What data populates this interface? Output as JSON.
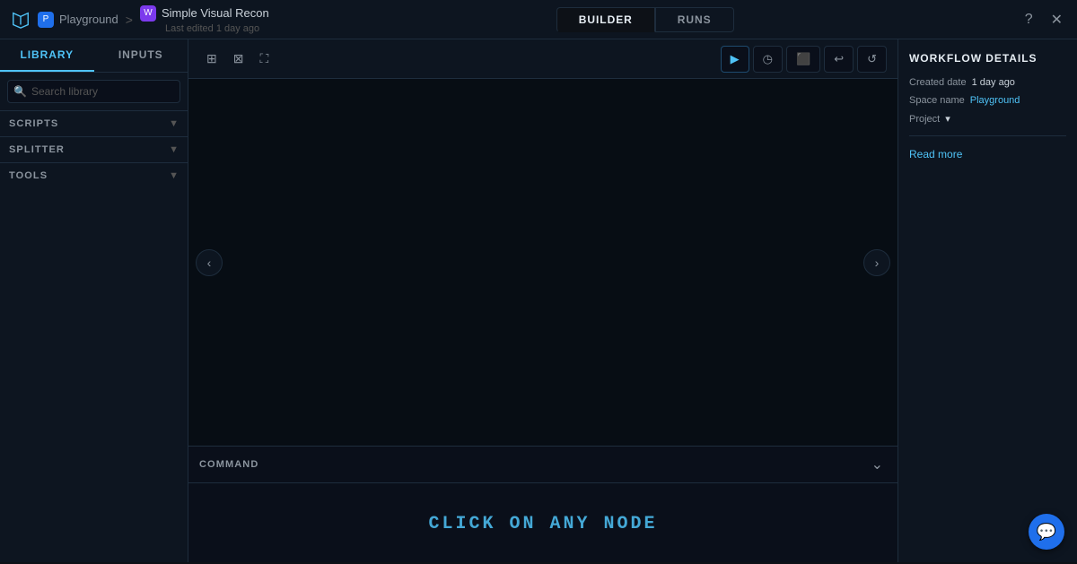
{
  "topbar": {
    "brand_icon": "▶",
    "breadcrumb": {
      "space_label": "Playground",
      "sep": ">",
      "workflow_label": "Simple Visual Recon"
    },
    "last_edited": "Last edited 1 day ago",
    "tabs": [
      {
        "id": "builder",
        "label": "BUILDER",
        "active": true
      },
      {
        "id": "runs",
        "label": "RUNS",
        "active": false
      }
    ],
    "help_icon": "?",
    "close_icon": "✕"
  },
  "sidebar": {
    "tabs": [
      {
        "id": "library",
        "label": "LIBRARY",
        "active": true
      },
      {
        "id": "inputs",
        "label": "INPUTS",
        "active": false
      }
    ],
    "search_placeholder": "Search library",
    "sections": [
      {
        "id": "scripts",
        "label": "SCRIPTS"
      },
      {
        "id": "splitter",
        "label": "SPLITTER"
      },
      {
        "id": "tools",
        "label": "TOOLS"
      }
    ]
  },
  "canvas": {
    "tools": [
      {
        "id": "grid",
        "icon": "⊞",
        "title": "Grid"
      },
      {
        "id": "cursor",
        "icon": "⊠",
        "title": "Cursor"
      },
      {
        "id": "expand",
        "icon": "⛶",
        "title": "Expand"
      }
    ],
    "actions": [
      {
        "id": "play",
        "icon": "▶",
        "title": "Run"
      },
      {
        "id": "timer",
        "icon": "◷",
        "title": "Schedule"
      },
      {
        "id": "save",
        "icon": "💾",
        "title": "Save"
      },
      {
        "id": "undo",
        "icon": "↩",
        "title": "Undo"
      },
      {
        "id": "history",
        "icon": "⟳",
        "title": "History"
      }
    ],
    "nav_left": "‹",
    "nav_right": "›"
  },
  "command": {
    "title": "COMMAND",
    "placeholder_text": "CLICK ON ANY NODE",
    "collapse_icon": "⌄"
  },
  "right_panel": {
    "title": "WORKFLOW DETAILS",
    "created_date_label": "Created date",
    "created_date_value": "1 day ago",
    "space_name_label": "Space name",
    "space_name_value": "Playground",
    "project_label": "Project",
    "project_value": "▾",
    "read_more_label": "Read more"
  },
  "chat": {
    "icon": "💬"
  }
}
